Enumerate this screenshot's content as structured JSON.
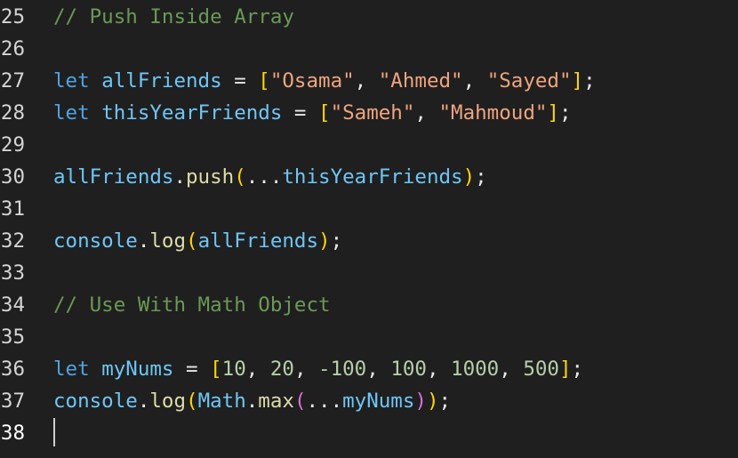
{
  "colors": {
    "background": "#1f1f1f",
    "keyword": "#4fa3e0",
    "variable": "#6ec6f6",
    "string": "#f0a47e",
    "number": "#b5cea8",
    "comment": "#6a9955",
    "function": "#dcdcaa",
    "bracket_level1": "#ffd700",
    "bracket_level2": "#da70d6"
  },
  "lines": [
    {
      "number": "25",
      "tokens": [
        {
          "text": "// Push Inside Array",
          "type": "cm"
        }
      ]
    },
    {
      "number": "26",
      "tokens": []
    },
    {
      "number": "27",
      "tokens": [
        {
          "text": "let",
          "type": "kw"
        },
        {
          "text": " ",
          "type": "plain"
        },
        {
          "text": "allFriends",
          "type": "var"
        },
        {
          "text": " = ",
          "type": "op"
        },
        {
          "text": "[",
          "type": "br1"
        },
        {
          "text": "\"Osama\"",
          "type": "str"
        },
        {
          "text": ", ",
          "type": "op"
        },
        {
          "text": "\"Ahmed\"",
          "type": "str"
        },
        {
          "text": ", ",
          "type": "op"
        },
        {
          "text": "\"Sayed\"",
          "type": "str"
        },
        {
          "text": "]",
          "type": "br1"
        },
        {
          "text": ";",
          "type": "op"
        }
      ]
    },
    {
      "number": "28",
      "tokens": [
        {
          "text": "let",
          "type": "kw"
        },
        {
          "text": " ",
          "type": "plain"
        },
        {
          "text": "thisYearFriends",
          "type": "var"
        },
        {
          "text": " = ",
          "type": "op"
        },
        {
          "text": "[",
          "type": "br1"
        },
        {
          "text": "\"Sameh\"",
          "type": "str"
        },
        {
          "text": ", ",
          "type": "op"
        },
        {
          "text": "\"Mahmoud\"",
          "type": "str"
        },
        {
          "text": "]",
          "type": "br1"
        },
        {
          "text": ";",
          "type": "op"
        }
      ]
    },
    {
      "number": "29",
      "tokens": []
    },
    {
      "number": "30",
      "tokens": [
        {
          "text": "allFriends",
          "type": "var"
        },
        {
          "text": ".",
          "type": "op"
        },
        {
          "text": "push",
          "type": "fn"
        },
        {
          "text": "(",
          "type": "br1"
        },
        {
          "text": "...",
          "type": "op"
        },
        {
          "text": "thisYearFriends",
          "type": "var"
        },
        {
          "text": ")",
          "type": "br1"
        },
        {
          "text": ";",
          "type": "op"
        }
      ]
    },
    {
      "number": "31",
      "tokens": []
    },
    {
      "number": "32",
      "tokens": [
        {
          "text": "console",
          "type": "var"
        },
        {
          "text": ".",
          "type": "op"
        },
        {
          "text": "log",
          "type": "fn"
        },
        {
          "text": "(",
          "type": "br1"
        },
        {
          "text": "allFriends",
          "type": "var"
        },
        {
          "text": ")",
          "type": "br1"
        },
        {
          "text": ";",
          "type": "op"
        }
      ]
    },
    {
      "number": "33",
      "tokens": []
    },
    {
      "number": "34",
      "tokens": [
        {
          "text": "// Use With Math Object",
          "type": "cm"
        }
      ]
    },
    {
      "number": "35",
      "tokens": []
    },
    {
      "number": "36",
      "tokens": [
        {
          "text": "let",
          "type": "kw"
        },
        {
          "text": " ",
          "type": "plain"
        },
        {
          "text": "myNums",
          "type": "var"
        },
        {
          "text": " = ",
          "type": "op"
        },
        {
          "text": "[",
          "type": "br1"
        },
        {
          "text": "10",
          "type": "num"
        },
        {
          "text": ", ",
          "type": "op"
        },
        {
          "text": "20",
          "type": "num"
        },
        {
          "text": ", ",
          "type": "op"
        },
        {
          "text": "-100",
          "type": "num"
        },
        {
          "text": ", ",
          "type": "op"
        },
        {
          "text": "100",
          "type": "num"
        },
        {
          "text": ", ",
          "type": "op"
        },
        {
          "text": "1000",
          "type": "num"
        },
        {
          "text": ", ",
          "type": "op"
        },
        {
          "text": "500",
          "type": "num"
        },
        {
          "text": "]",
          "type": "br1"
        },
        {
          "text": ";",
          "type": "op"
        }
      ]
    },
    {
      "number": "37",
      "tokens": [
        {
          "text": "console",
          "type": "var"
        },
        {
          "text": ".",
          "type": "op"
        },
        {
          "text": "log",
          "type": "fn"
        },
        {
          "text": "(",
          "type": "br1"
        },
        {
          "text": "Math",
          "type": "var"
        },
        {
          "text": ".",
          "type": "op"
        },
        {
          "text": "max",
          "type": "fn"
        },
        {
          "text": "(",
          "type": "br2"
        },
        {
          "text": "...",
          "type": "op"
        },
        {
          "text": "myNums",
          "type": "var"
        },
        {
          "text": ")",
          "type": "br2"
        },
        {
          "text": ")",
          "type": "br1"
        },
        {
          "text": ";",
          "type": "op"
        }
      ]
    },
    {
      "number": "38",
      "tokens": [],
      "current": true
    }
  ]
}
